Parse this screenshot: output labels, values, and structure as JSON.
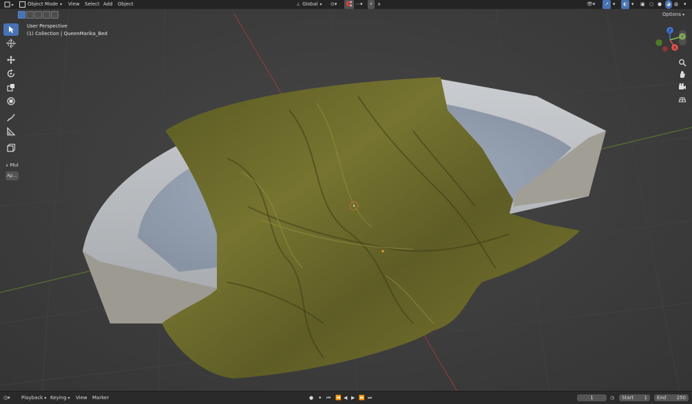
{
  "header": {
    "mode_label": "Object Mode",
    "menu": {
      "view": "View",
      "select": "Select",
      "add": "Add",
      "object": "Object"
    },
    "orientation_label": "Global",
    "options_label": "Options"
  },
  "overlay": {
    "view_name": "User Perspective",
    "collection_path": "(1) Collection | QueenMarika_Bed"
  },
  "sidebar_panel": {
    "collapsed_label": "Mul",
    "apply_button": "Ap..."
  },
  "gizmo": {
    "x": "X",
    "y": "Y",
    "z": "Z"
  },
  "timeline": {
    "playback": "Playback",
    "keying": "Keying",
    "view": "View",
    "marker": "Marker",
    "current_frame": "1",
    "start_label": "Start",
    "start_value": "1",
    "end_label": "End",
    "end_value": "250"
  },
  "colors": {
    "accent": "#4772b3",
    "axis_x": "#e5534f",
    "axis_y": "#8bc34a",
    "axis_z": "#3f7ad8",
    "cloth": "#6b6a2a"
  }
}
